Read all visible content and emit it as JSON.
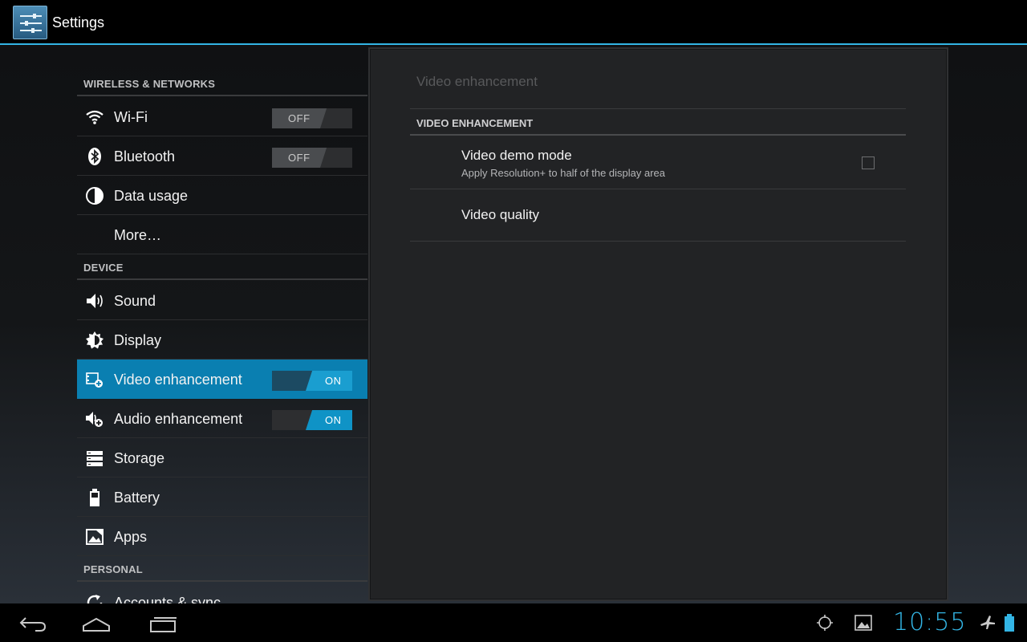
{
  "action_bar": {
    "title": "Settings",
    "icon": "settings-app-icon"
  },
  "left_list": {
    "sections": [
      {
        "header": "WIRELESS & NETWORKS"
      },
      {
        "header": "DEVICE"
      },
      {
        "header": "PERSONAL"
      }
    ],
    "items": [
      {
        "label": "Wi-Fi",
        "icon": "wifi-icon",
        "toggle": "OFF"
      },
      {
        "label": "Bluetooth",
        "icon": "bluetooth-icon",
        "toggle": "OFF"
      },
      {
        "label": "Data usage",
        "icon": "data-usage-icon"
      },
      {
        "label": "More…"
      },
      {
        "label": "Sound",
        "icon": "sound-icon"
      },
      {
        "label": "Display",
        "icon": "display-icon"
      },
      {
        "label": "Video enhancement",
        "icon": "video-enhancement-icon",
        "toggle": "ON",
        "selected": true
      },
      {
        "label": "Audio enhancement",
        "icon": "audio-enhancement-icon",
        "toggle": "ON"
      },
      {
        "label": "Storage",
        "icon": "storage-icon"
      },
      {
        "label": "Battery",
        "icon": "battery-icon"
      },
      {
        "label": "Apps",
        "icon": "apps-icon"
      },
      {
        "label": "Accounts & sync",
        "icon": "sync-icon"
      }
    ]
  },
  "detail": {
    "title": "Video enhancement",
    "section": "VIDEO ENHANCEMENT",
    "prefs": [
      {
        "title": "Video demo mode",
        "summary": "Apply Resolution+ to half of the display area",
        "checked": false
      },
      {
        "title": "Video quality"
      }
    ]
  },
  "nav_bar": {
    "buttons": [
      "back-icon",
      "home-icon",
      "recent-apps-icon"
    ],
    "status_icons": [
      "gps-icon",
      "gallery-icon",
      "airplane-mode-icon",
      "battery-icon"
    ],
    "clock": "10:55"
  },
  "colors": {
    "accent": "#33b5e5",
    "selected": "#0a7fb1"
  }
}
